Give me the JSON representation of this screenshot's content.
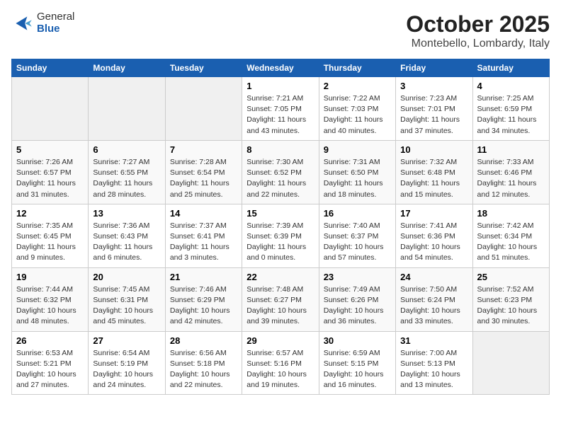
{
  "header": {
    "logo_general": "General",
    "logo_blue": "Blue",
    "month": "October 2025",
    "location": "Montebello, Lombardy, Italy"
  },
  "days_of_week": [
    "Sunday",
    "Monday",
    "Tuesday",
    "Wednesday",
    "Thursday",
    "Friday",
    "Saturday"
  ],
  "weeks": [
    [
      {
        "day": "",
        "info": ""
      },
      {
        "day": "",
        "info": ""
      },
      {
        "day": "",
        "info": ""
      },
      {
        "day": "1",
        "info": "Sunrise: 7:21 AM\nSunset: 7:05 PM\nDaylight: 11 hours\nand 43 minutes."
      },
      {
        "day": "2",
        "info": "Sunrise: 7:22 AM\nSunset: 7:03 PM\nDaylight: 11 hours\nand 40 minutes."
      },
      {
        "day": "3",
        "info": "Sunrise: 7:23 AM\nSunset: 7:01 PM\nDaylight: 11 hours\nand 37 minutes."
      },
      {
        "day": "4",
        "info": "Sunrise: 7:25 AM\nSunset: 6:59 PM\nDaylight: 11 hours\nand 34 minutes."
      }
    ],
    [
      {
        "day": "5",
        "info": "Sunrise: 7:26 AM\nSunset: 6:57 PM\nDaylight: 11 hours\nand 31 minutes."
      },
      {
        "day": "6",
        "info": "Sunrise: 7:27 AM\nSunset: 6:55 PM\nDaylight: 11 hours\nand 28 minutes."
      },
      {
        "day": "7",
        "info": "Sunrise: 7:28 AM\nSunset: 6:54 PM\nDaylight: 11 hours\nand 25 minutes."
      },
      {
        "day": "8",
        "info": "Sunrise: 7:30 AM\nSunset: 6:52 PM\nDaylight: 11 hours\nand 22 minutes."
      },
      {
        "day": "9",
        "info": "Sunrise: 7:31 AM\nSunset: 6:50 PM\nDaylight: 11 hours\nand 18 minutes."
      },
      {
        "day": "10",
        "info": "Sunrise: 7:32 AM\nSunset: 6:48 PM\nDaylight: 11 hours\nand 15 minutes."
      },
      {
        "day": "11",
        "info": "Sunrise: 7:33 AM\nSunset: 6:46 PM\nDaylight: 11 hours\nand 12 minutes."
      }
    ],
    [
      {
        "day": "12",
        "info": "Sunrise: 7:35 AM\nSunset: 6:45 PM\nDaylight: 11 hours\nand 9 minutes."
      },
      {
        "day": "13",
        "info": "Sunrise: 7:36 AM\nSunset: 6:43 PM\nDaylight: 11 hours\nand 6 minutes."
      },
      {
        "day": "14",
        "info": "Sunrise: 7:37 AM\nSunset: 6:41 PM\nDaylight: 11 hours\nand 3 minutes."
      },
      {
        "day": "15",
        "info": "Sunrise: 7:39 AM\nSunset: 6:39 PM\nDaylight: 11 hours\nand 0 minutes."
      },
      {
        "day": "16",
        "info": "Sunrise: 7:40 AM\nSunset: 6:37 PM\nDaylight: 10 hours\nand 57 minutes."
      },
      {
        "day": "17",
        "info": "Sunrise: 7:41 AM\nSunset: 6:36 PM\nDaylight: 10 hours\nand 54 minutes."
      },
      {
        "day": "18",
        "info": "Sunrise: 7:42 AM\nSunset: 6:34 PM\nDaylight: 10 hours\nand 51 minutes."
      }
    ],
    [
      {
        "day": "19",
        "info": "Sunrise: 7:44 AM\nSunset: 6:32 PM\nDaylight: 10 hours\nand 48 minutes."
      },
      {
        "day": "20",
        "info": "Sunrise: 7:45 AM\nSunset: 6:31 PM\nDaylight: 10 hours\nand 45 minutes."
      },
      {
        "day": "21",
        "info": "Sunrise: 7:46 AM\nSunset: 6:29 PM\nDaylight: 10 hours\nand 42 minutes."
      },
      {
        "day": "22",
        "info": "Sunrise: 7:48 AM\nSunset: 6:27 PM\nDaylight: 10 hours\nand 39 minutes."
      },
      {
        "day": "23",
        "info": "Sunrise: 7:49 AM\nSunset: 6:26 PM\nDaylight: 10 hours\nand 36 minutes."
      },
      {
        "day": "24",
        "info": "Sunrise: 7:50 AM\nSunset: 6:24 PM\nDaylight: 10 hours\nand 33 minutes."
      },
      {
        "day": "25",
        "info": "Sunrise: 7:52 AM\nSunset: 6:23 PM\nDaylight: 10 hours\nand 30 minutes."
      }
    ],
    [
      {
        "day": "26",
        "info": "Sunrise: 6:53 AM\nSunset: 5:21 PM\nDaylight: 10 hours\nand 27 minutes."
      },
      {
        "day": "27",
        "info": "Sunrise: 6:54 AM\nSunset: 5:19 PM\nDaylight: 10 hours\nand 24 minutes."
      },
      {
        "day": "28",
        "info": "Sunrise: 6:56 AM\nSunset: 5:18 PM\nDaylight: 10 hours\nand 22 minutes."
      },
      {
        "day": "29",
        "info": "Sunrise: 6:57 AM\nSunset: 5:16 PM\nDaylight: 10 hours\nand 19 minutes."
      },
      {
        "day": "30",
        "info": "Sunrise: 6:59 AM\nSunset: 5:15 PM\nDaylight: 10 hours\nand 16 minutes."
      },
      {
        "day": "31",
        "info": "Sunrise: 7:00 AM\nSunset: 5:13 PM\nDaylight: 10 hours\nand 13 minutes."
      },
      {
        "day": "",
        "info": ""
      }
    ]
  ]
}
